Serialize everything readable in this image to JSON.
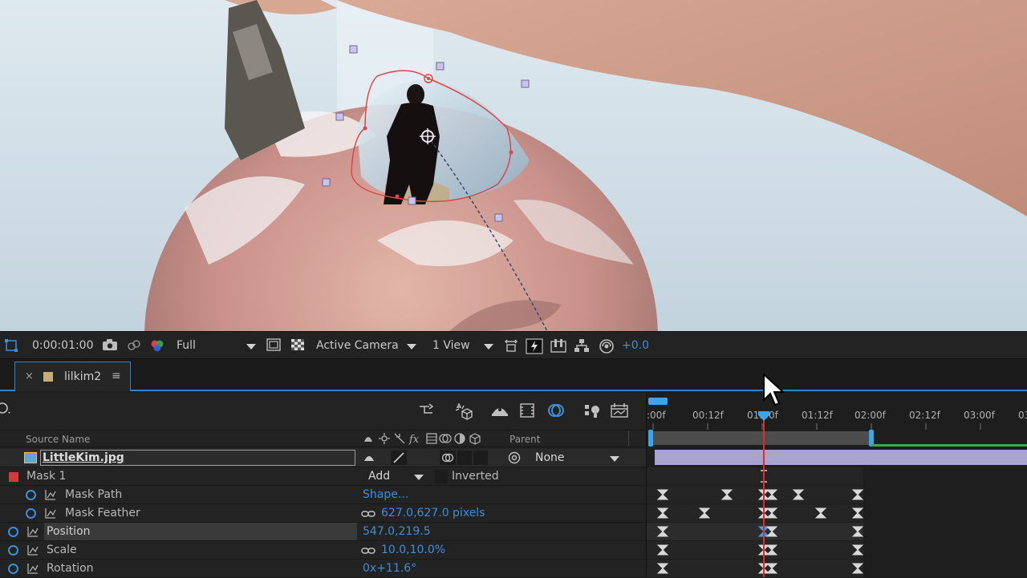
{
  "viewer_toolbar": {
    "timecode": "0:00:01:00",
    "resolution": "Full",
    "camera": "Active Camera",
    "views": "1 View",
    "exposure": "+0.0"
  },
  "timeline": {
    "tab_name": "lilkim2",
    "columns": {
      "source_name": "Source Name",
      "parent": "Parent"
    },
    "layer": {
      "name": "LittleKim.jpg",
      "parent": "None"
    },
    "mask": {
      "name": "Mask 1",
      "mode": "Add",
      "inverted_label": "Inverted"
    },
    "properties": [
      {
        "name": "Mask Path",
        "value": "Shape..."
      },
      {
        "name": "Mask Feather",
        "value": "627.0,627.0  pixels"
      },
      {
        "name": "Position",
        "value": "547.0,219.5"
      },
      {
        "name": "Scale",
        "value": "10.0,10.0%"
      },
      {
        "name": "Rotation",
        "value": "0x+11.6°"
      }
    ],
    "ruler": [
      ":00f",
      "00:12f",
      "01:00f",
      "01:12f",
      "02:00f",
      "02:12f",
      "03:00f",
      "03"
    ]
  },
  "colors": {
    "accent": "#3d8fd8",
    "playhead": "#e02b2b",
    "mask_path": "#e04545",
    "layer_bar": "#a9a4cf",
    "work_area": "#3fa83f"
  }
}
